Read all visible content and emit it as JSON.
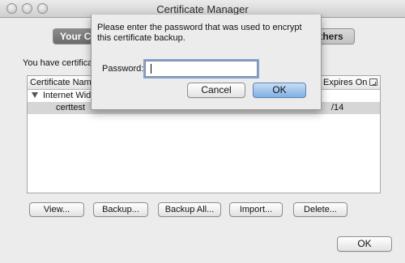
{
  "window": {
    "title": "Certificate Manager"
  },
  "tabs": {
    "left_label": "Your Certificates",
    "right_label": "Others"
  },
  "main": {
    "intro_text": "You have certificates from these organizations that identify you:"
  },
  "table": {
    "columns": [
      {
        "label": "Certificate Name"
      },
      {
        "label": "Expires On"
      }
    ],
    "group": {
      "label": "Internet Widgits Pty Ltd"
    },
    "row": {
      "name": "certtest",
      "expires": "/14"
    }
  },
  "buttons": {
    "view": "View...",
    "backup": "Backup...",
    "backup_all": "Backup All...",
    "import": "Import...",
    "delete": "Delete...",
    "ok": "OK"
  },
  "sheet": {
    "message": "Please enter the password that was used to encrypt this certificate backup.",
    "password_label": "Password:",
    "password_value": "",
    "cancel_label": "Cancel",
    "ok_label": "OK"
  }
}
